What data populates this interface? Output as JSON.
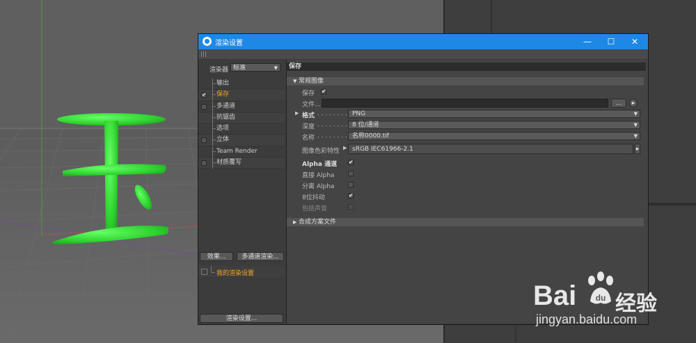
{
  "window": {
    "title": "渲染设置",
    "controls": {
      "minimize": "—",
      "maximize": "☐",
      "close": "✕"
    }
  },
  "left_panel": {
    "renderer_label": "渲染器",
    "renderer_value": "标准",
    "items": [
      {
        "label": "输出",
        "checkbox": false,
        "checked": false,
        "active": false
      },
      {
        "label": "保存",
        "checkbox": true,
        "checked": true,
        "active": true
      },
      {
        "label": "多通道",
        "checkbox": true,
        "checked": false,
        "active": false
      },
      {
        "label": "抗锯齿",
        "checkbox": false,
        "checked": false,
        "active": false
      },
      {
        "label": "选项",
        "checkbox": false,
        "checked": false,
        "active": false
      },
      {
        "label": "立体",
        "checkbox": true,
        "checked": false,
        "active": false
      },
      {
        "label": "Team Render",
        "checkbox": false,
        "checked": false,
        "active": false
      },
      {
        "label": "材质覆写",
        "checkbox": true,
        "checked": false,
        "active": false
      }
    ],
    "effects_button": "效果...",
    "multipass_button": "多通道渲染...",
    "setting_item": "我的渲染设置",
    "render_settings_button": "渲染设置..."
  },
  "right_panel": {
    "section_title": "保存",
    "group_regular": "常规图像",
    "save_label": "保存",
    "save_checked": true,
    "file_label": "文件...",
    "file_value": "",
    "browse_button": "...",
    "format_label": "格式",
    "format_value": "PNG",
    "depth_label": "深度",
    "depth_value": "8 位/通道",
    "name_label": "名称",
    "name_value": "名称0000.tif",
    "color_profile_label": "图像色彩特性",
    "color_profile_value": "sRGB IEC61966-2.1",
    "alpha_channel_label": "Alpha 通道",
    "alpha_channel_checked": true,
    "straight_alpha_label": "直接 Alpha",
    "straight_alpha_checked": false,
    "separate_alpha_label": "分离 Alpha",
    "separate_alpha_checked": false,
    "dither_label": "8位抖动",
    "dither_checked": true,
    "include_sound_label": "包括声音",
    "include_sound_checked": false,
    "group_compositing": "合成方案文件"
  },
  "watermark": {
    "brand": "Bai",
    "brand_suffix": "经验",
    "url": "jingyan.baidu.com"
  },
  "colors": {
    "titlebar": "#1e88e5",
    "active_item": "#f5a623",
    "model_green": "#33dd33"
  }
}
